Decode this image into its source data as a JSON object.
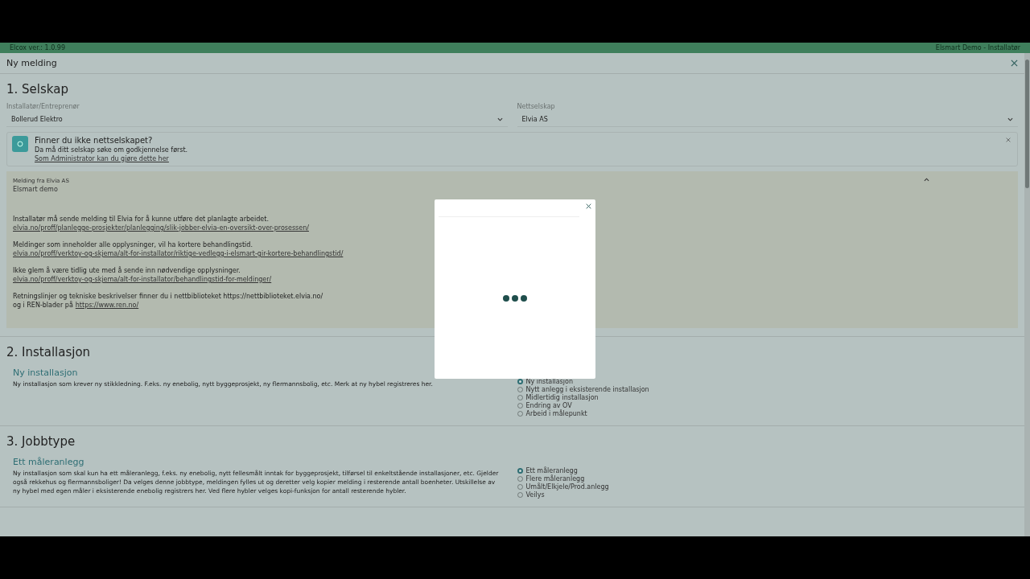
{
  "top_bar": {
    "version": "Elcox ver.: 1.0.99",
    "user": "Elsmart Demo - Installatør"
  },
  "dialog": {
    "title": "Ny melding"
  },
  "section_1": {
    "heading": "1. Selskap",
    "fields": [
      {
        "label": "Installatør/Entreprenør",
        "value": "Bollerud Elektro"
      },
      {
        "label": "Nettselskap",
        "value": "Elvia AS"
      }
    ],
    "alert": {
      "title": "Finner du ikke nettselskapet?",
      "text": "Da må ditt selskap søke om godkjennelse først.",
      "link": "Som Administrator kan du gjøre dette her"
    },
    "message": {
      "expanded": true,
      "label": "Melding fra Elvia AS",
      "title": "Elsmart demo",
      "paragraphs": [
        [
          {
            "text": "Installatør må sende melding til Elvia for å kunne utføre det planlagte arbeidet."
          },
          {
            "link": "elvia.no/proff/planlegge-prosjekter/planlegging/slik-jobber-elvia-en-oversikt-over-prosessen/"
          }
        ],
        [
          {
            "text": "Meldinger som inneholder alle opplysninger, vil ha kortere behandlingstid."
          },
          {
            "link": "elvia.no/proff/verktoy-og-skjema/alt-for-installator/riktige-vedlegg-i-elsmart-gir-kortere-behandlingstid/"
          }
        ],
        [
          {
            "text": "Ikke glem å være tidlig ute med å sende inn nødvendige opplysninger."
          },
          {
            "link": "elvia.no/proff/verktoy-og-skjema/alt-for-installator/behandlingstid-for-meldinger/"
          }
        ],
        [
          {
            "text": "Retningslinjer og tekniske beskrivelser finner du i nettbiblioteket https://nettbiblioteket.elvia.no/"
          },
          {
            "text": "og i REN-blader på",
            "link": "https://www.ren.no/"
          }
        ]
      ]
    }
  },
  "section_2": {
    "heading": "2. Installasjon",
    "subheading": "Ny installasjon",
    "description": "Ny installasjon som krever ny stikkledning. F.eks. ny enebolig, nytt byggeprosjekt, ny flermannsbolig, etc. Merk at ny hybel registreres her.",
    "options": [
      {
        "label": "Ny installasjon",
        "selected": true
      },
      {
        "label": "Nytt anlegg i eksisterende installasjon",
        "selected": false
      },
      {
        "label": "Midlertidig installasjon",
        "selected": false
      },
      {
        "label": "Endring av OV",
        "selected": false
      },
      {
        "label": "Arbeid i målepunkt",
        "selected": false
      }
    ]
  },
  "section_3": {
    "heading": "3. Jobbtype",
    "subheading": "Ett måleranlegg",
    "description": "Ny installasjon som skal kun ha ett måleranlegg, f.eks. ny enebolig, nytt fellesmålt inntak for byggeprosjekt, tilførsel til enkeltstående installasjoner, etc. Gjelder også rekkehus og flermannsboliger! Da velges denne jobbtype, meldingen fylles ut og deretter velg kopier melding i resterende antall boenheter. Utskillelse av ny hybel med egen måler i eksisterende enebolig registrers her. Ved flere hybler velges kopi-funksjon for antall resterende hybler.",
    "options": [
      {
        "label": "Ett måleranlegg",
        "selected": true
      },
      {
        "label": "Flere måleranlegg",
        "selected": false
      },
      {
        "label": "Umålt/Elkjele/Prod.anlegg",
        "selected": false
      },
      {
        "label": "Veilys",
        "selected": false
      }
    ]
  },
  "loading_modal": {
    "loading": true
  }
}
